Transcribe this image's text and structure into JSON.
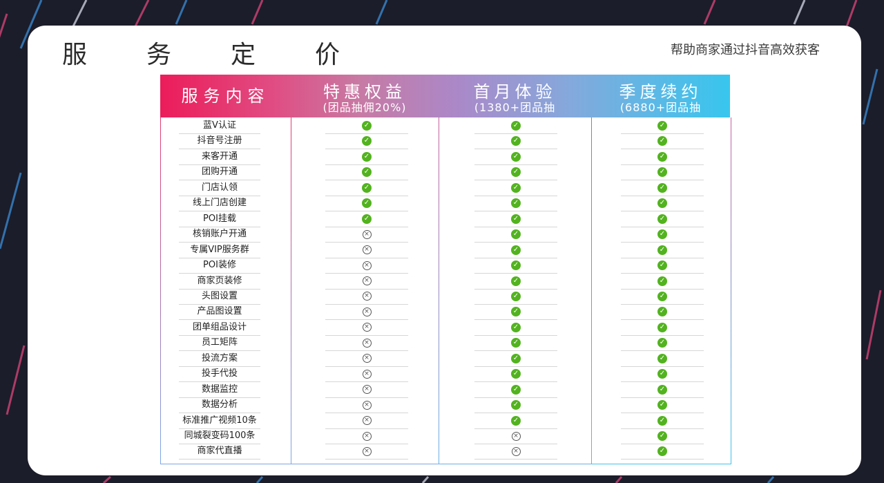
{
  "page": {
    "title_chars": [
      "服",
      "务",
      "定",
      "价"
    ],
    "subtitle": "帮助商家通过抖音高效获客"
  },
  "table": {
    "headers": [
      {
        "title": "服务内容",
        "sub": ""
      },
      {
        "title": "特惠权益",
        "sub": "(团品抽佣20%)"
      },
      {
        "title": "首月体验",
        "sub": "(1380+团品抽"
      },
      {
        "title": "季度续约",
        "sub": "(6880+团品抽"
      }
    ],
    "rows": [
      {
        "label": "蓝V认证",
        "values": [
          "check-icon",
          "check-icon",
          "check-icon"
        ]
      },
      {
        "label": "抖音号注册",
        "values": [
          "check-icon",
          "check-icon",
          "check-icon"
        ]
      },
      {
        "label": "来客开通",
        "values": [
          "check-icon",
          "check-icon",
          "check-icon"
        ]
      },
      {
        "label": "团购开通",
        "values": [
          "check-icon",
          "check-icon",
          "check-icon"
        ]
      },
      {
        "label": "门店认领",
        "values": [
          "check-icon",
          "check-icon",
          "check-icon"
        ]
      },
      {
        "label": "线上门店创建",
        "values": [
          "check-icon",
          "check-icon",
          "check-icon"
        ]
      },
      {
        "label": "POI挂载",
        "values": [
          "check-icon",
          "check-icon",
          "check-icon"
        ]
      },
      {
        "label": "核销账户开通",
        "values": [
          "cross-icon",
          "check-icon",
          "check-icon"
        ]
      },
      {
        "label": "专属VIP服务群",
        "values": [
          "cross-icon",
          "check-icon",
          "check-icon"
        ]
      },
      {
        "label": "POI装修",
        "values": [
          "cross-icon",
          "check-icon",
          "check-icon"
        ]
      },
      {
        "label": "商家页装修",
        "values": [
          "cross-icon",
          "check-icon",
          "check-icon"
        ]
      },
      {
        "label": "头图设置",
        "values": [
          "cross-icon",
          "check-icon",
          "check-icon"
        ]
      },
      {
        "label": "产品图设置",
        "values": [
          "cross-icon",
          "check-icon",
          "check-icon"
        ]
      },
      {
        "label": "团单组品设计",
        "values": [
          "cross-icon",
          "check-icon",
          "check-icon"
        ]
      },
      {
        "label": "员工矩阵",
        "values": [
          "cross-icon",
          "check-icon",
          "check-icon"
        ]
      },
      {
        "label": "投流方案",
        "values": [
          "cross-icon",
          "check-icon",
          "check-icon"
        ]
      },
      {
        "label": "投手代投",
        "values": [
          "cross-icon",
          "check-icon",
          "check-icon"
        ]
      },
      {
        "label": "数据监控",
        "values": [
          "cross-icon",
          "check-icon",
          "check-icon"
        ]
      },
      {
        "label": "数据分析",
        "values": [
          "cross-icon",
          "check-icon",
          "check-icon"
        ]
      },
      {
        "label": "标准推广视频10条",
        "values": [
          "cross-icon",
          "check-icon",
          "check-icon"
        ]
      },
      {
        "label": "同城裂变码100条",
        "values": [
          "cross-icon",
          "cross-icon",
          "check-icon"
        ]
      },
      {
        "label": "商家代直播",
        "values": [
          "cross-icon",
          "cross-icon",
          "check-icon"
        ]
      }
    ]
  },
  "colors": {
    "check": "#52b31f",
    "header_start": "#ec1c5a",
    "header_end": "#37c6ee"
  }
}
